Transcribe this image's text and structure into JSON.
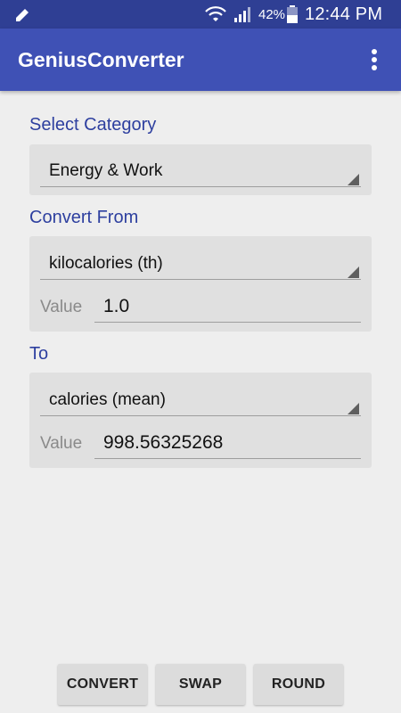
{
  "status_bar": {
    "battery_percent": "42%",
    "time": "12:44 PM",
    "icons": [
      "pencil-icon",
      "wifi-icon",
      "signal-icon",
      "battery-icon"
    ]
  },
  "app_bar": {
    "title": "GeniusConverter",
    "menu_icon": "more-vert-icon"
  },
  "category": {
    "label": "Select Category",
    "selected": "Energy & Work"
  },
  "from": {
    "label": "Convert From",
    "unit": "kilocalories (th)",
    "value_label": "Value",
    "value": "1.0"
  },
  "to": {
    "label": "To",
    "unit": "calories (mean)",
    "value_label": "Value",
    "value": "998.56325268"
  },
  "buttons": {
    "convert": "CONVERT",
    "swap": "SWAP",
    "round": "ROUND"
  },
  "colors": {
    "status_bar": "#2f3f94",
    "app_bar": "#3f51b5",
    "accent_text": "#2d3f9f",
    "background": "#eeeeee"
  }
}
